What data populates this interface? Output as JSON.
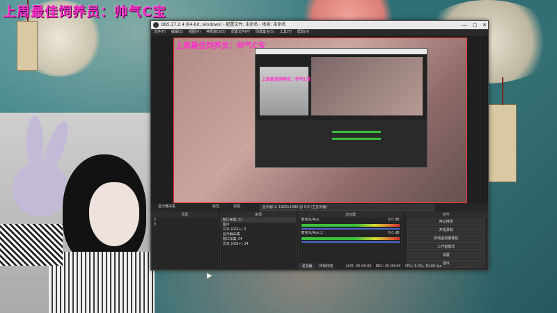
{
  "overlay": {
    "title": "上周最佳饲养员：帅气C宝"
  },
  "obs": {
    "window_title": "OBS 27.2.4 (64-bit, windows) - 配置文件: 未命名 - 场景: 未命名",
    "window_controls": [
      "—",
      "□",
      "✕"
    ],
    "menu": [
      "文件(F)",
      "编辑(E)",
      "视图(V)",
      "停靠窗口(D)",
      "配置文件(P)",
      "场景集合(S)",
      "工具(T)",
      "帮助(H)"
    ],
    "preview": {
      "title": "上周最佳饲养员：帅气C宝",
      "nested_title": "上周最佳饲养员：帅气C宝"
    },
    "scene_bar": {
      "label": "显示器采集",
      "properties": "属性",
      "filters": "滤镜",
      "display": "显示器 1: 1920x1080 @ 0,0 (主显示器)"
    },
    "scenes": {
      "header": "场景",
      "items": [
        "2",
        "3"
      ]
    },
    "sources": {
      "header": "来源",
      "items": [
        "窗口采集 31",
        "图片",
        "文本 (GDI+) 3",
        "显示器采集",
        "窗口采集 34",
        "文本 (GDI+) 34"
      ]
    },
    "mixer": {
      "header": "混音器",
      "channels": [
        {
          "name": "麦克风/Aux",
          "level": "0.0 dB"
        },
        {
          "name": "麦克风/Aux 2",
          "level": "0.0 dB"
        }
      ],
      "tabs": [
        "混音器",
        "转场特效"
      ]
    },
    "controls": {
      "header": "控件",
      "buttons": [
        "停止推流",
        "开始录制",
        "启动虚拟摄像机",
        "工作室模式",
        "设置",
        "退出"
      ]
    },
    "status": {
      "live": "LIVE: 00:00:00",
      "rec": "REC: 00:00:00",
      "cpu": "CPU: 1.0%, 30.00 fps"
    }
  }
}
